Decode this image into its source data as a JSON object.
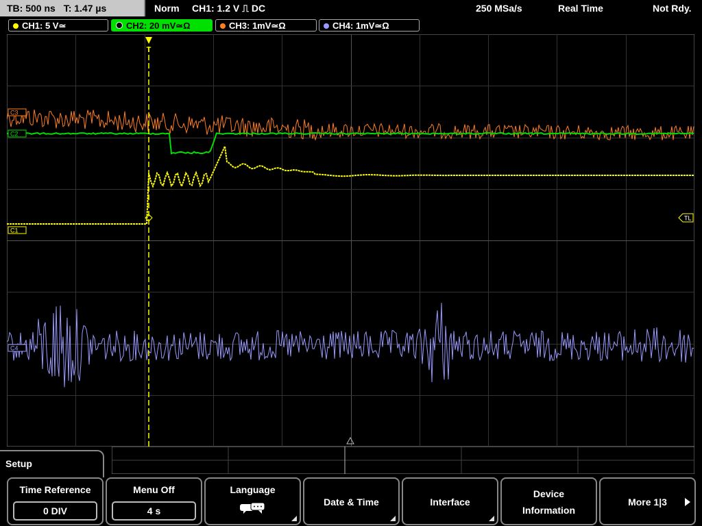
{
  "header": {
    "timebase": "TB: 500 ns",
    "trigger_time": "T: 1.47 µs",
    "mode": "Norm",
    "trigger": "CH1: 1.2 V ⎍ DC",
    "sample_rate": "250 MSa/s",
    "acq_mode": "Real Time",
    "status": "Not Rdy."
  },
  "channels": [
    {
      "label": "CH1: 5 V≃",
      "color": "#ffff00",
      "active": false
    },
    {
      "label": "CH2: 20 mV≃Ω",
      "color": "#00e000",
      "active": true
    },
    {
      "label": "CH3: 1mV≃Ω",
      "color": "#ff7f20",
      "active": false
    },
    {
      "label": "CH4: 1mV≃Ω",
      "color": "#9999ff",
      "active": false
    }
  ],
  "markers": {
    "ch1": "C1",
    "ch2": "C2",
    "ch3": "C3",
    "ch4": "C4",
    "trigger_level": "TL",
    "trigger_pos": "T"
  },
  "menu": {
    "title": "Setup",
    "softkeys": [
      {
        "label": "Time Reference",
        "value": "0 DIV"
      },
      {
        "label": "Menu Off",
        "value": "4 s"
      },
      {
        "label": "Language",
        "icon": "speech-bubbles-icon"
      },
      {
        "label": "Date & Time"
      },
      {
        "label": "Interface"
      },
      {
        "label": "Device",
        "label2": "Information"
      },
      {
        "label": "More 1|3"
      }
    ]
  },
  "colors": {
    "ch1": "#ffff00",
    "ch2": "#00e000",
    "ch3": "#ff7f20",
    "ch4": "#9999ff",
    "grid": "#444444"
  }
}
